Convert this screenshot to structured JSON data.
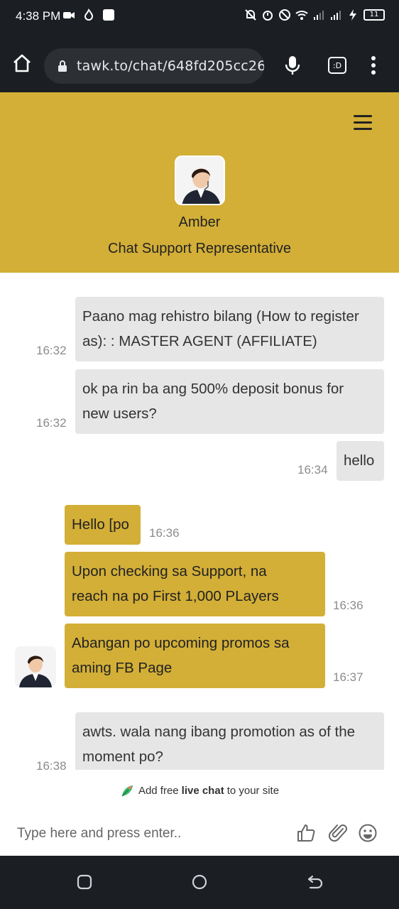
{
  "status_bar": {
    "time": "4:38 PM",
    "battery": "11",
    "icons": [
      "video-icon",
      "flame-icon",
      "square-icon",
      "mute-icon",
      "alarm-icon",
      "dnd-icon",
      "wifi-icon",
      "signal-icon",
      "signal-icon",
      "charging-icon"
    ]
  },
  "browser": {
    "url": "tawk.to/chat/648fd205cc26",
    "tabs_label": ":D",
    "icons": [
      "home-icon",
      "lock-icon",
      "mic-icon",
      "tabs-icon",
      "more-vert-icon"
    ]
  },
  "header": {
    "agent_name": "Amber",
    "agent_role": "Chat Support Representative",
    "accent_color": "#d3af37"
  },
  "messages": [
    {
      "sender": "visitor",
      "text_lines": [
        "Paano mag rehistro bilang (How to register",
        "as): : MASTER AGENT (AFFILIATE)"
      ],
      "time": "16:32"
    },
    {
      "sender": "visitor",
      "text_lines": [
        "ok pa rin ba ang 500% deposit bonus for",
        "new users?"
      ],
      "time": "16:32"
    },
    {
      "sender": "me",
      "text_lines": [
        "hello"
      ],
      "time": "16:34"
    },
    {
      "sender": "agent",
      "text_lines": [
        "Hello [po"
      ],
      "time": "16:36"
    },
    {
      "sender": "agent",
      "text_lines": [
        "Upon checking sa Support, na",
        "reach na po First 1,000 PLayers"
      ],
      "time": "16:36"
    },
    {
      "sender": "agent",
      "text_lines": [
        "Abangan po upcoming promos sa",
        "aming FB Page"
      ],
      "time": "16:37"
    },
    {
      "sender": "visitor",
      "text_lines": [
        "awts. wala nang ibang promotion as of the",
        "moment po?"
      ],
      "time": "16:38"
    }
  ],
  "footer": {
    "powered_prefix": "Add free",
    "powered_bold": "live chat",
    "powered_suffix": "to your site",
    "input_placeholder": "Type here and press enter.."
  }
}
